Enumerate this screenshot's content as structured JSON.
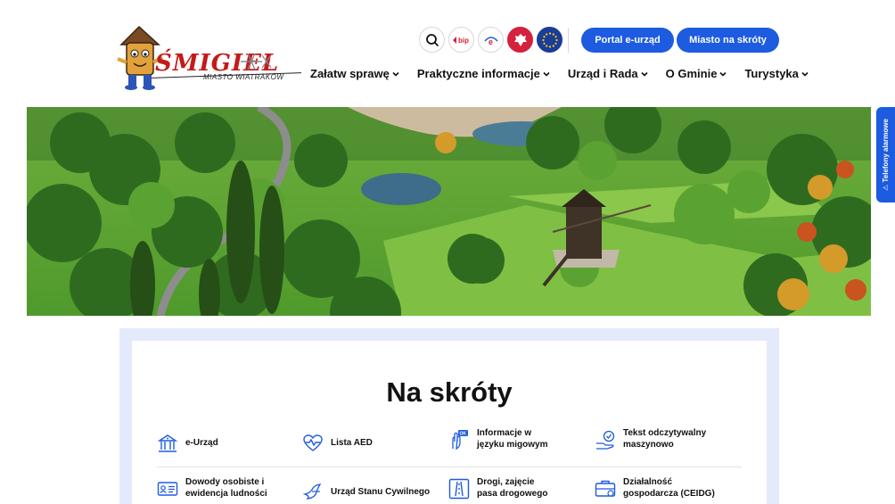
{
  "header": {
    "logo_word": "ŚMIGIEL",
    "logo_sub": "MIASTO WIATRAKÓW",
    "icons": [
      {
        "name": "search-icon",
        "label": ""
      },
      {
        "name": "bip-icon",
        "label": "bip"
      },
      {
        "name": "epuap-icon",
        "label": "e"
      },
      {
        "name": "poland-emblem-icon",
        "label": ""
      },
      {
        "name": "eu-flag-icon",
        "label": ""
      }
    ],
    "buttons": {
      "portal": "Portal e-urząd",
      "shortcuts": "Miasto na skróty"
    },
    "nav": [
      "Załatw sprawę",
      "Praktyczne informacje",
      "Urząd i Rada",
      "O Gminie",
      "Turystyka"
    ]
  },
  "side_tab": "⚠ Telefony alarmowe",
  "shortcuts": {
    "title": "Na skróty",
    "items": [
      {
        "line1": "e-Urząd",
        "line2": "",
        "icon": "building-icon"
      },
      {
        "line1": "Lista AED",
        "line2": "",
        "icon": "heart-pulse-icon"
      },
      {
        "line1": "Informacje w",
        "line2": "języku migowym",
        "icon": "sign-language-icon"
      },
      {
        "line1": "Tekst odczytywalny",
        "line2": "maszynowo",
        "icon": "readable-text-icon"
      },
      {
        "line1": "Dowody osobiste i",
        "line2": "ewidencja ludności",
        "icon": "id-card-icon"
      },
      {
        "line1": "Urząd Stanu Cywilnego",
        "line2": "",
        "icon": "doves-icon"
      },
      {
        "line1": "Drogi, zajęcie",
        "line2": "pasa drogowego",
        "icon": "road-icon"
      },
      {
        "line1": "Działalność",
        "line2": "gospodarcza (CEIDG)",
        "icon": "briefcase-icon"
      }
    ]
  },
  "colors": {
    "accent": "#1d5be0",
    "logo_red": "#c51a1a",
    "panel_bg": "#e4eafc"
  }
}
